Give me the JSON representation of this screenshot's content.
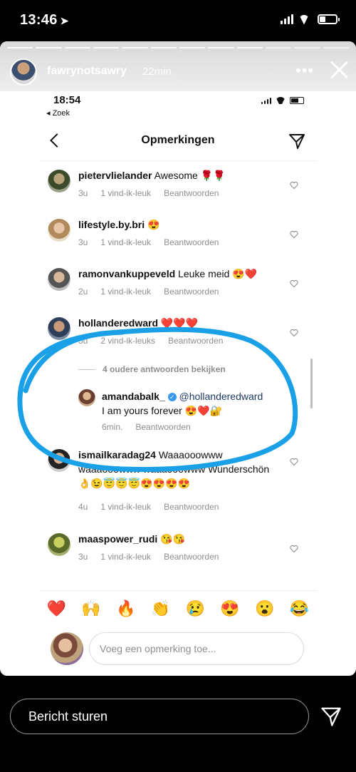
{
  "status_bar": {
    "time": "13:46"
  },
  "story": {
    "username": "fawrynotsawry",
    "time_ago": "22min.",
    "more": "•••"
  },
  "inner": {
    "time": "18:54",
    "back_label": "◂ Zoek",
    "title": "Opmerkingen",
    "comments": [
      {
        "user": "pietervlielander",
        "text": "Awesome 🌹🌹",
        "age": "3u",
        "likes": "1 vind-ik-leuk",
        "reply": "Beantwoorden"
      },
      {
        "user": "lifestyle.by.bri",
        "text": "😍",
        "age": "3u",
        "likes": "1 vind-ik-leuk",
        "reply": "Beantwoorden"
      },
      {
        "user": "ramonvankuppeveld",
        "text": "Leuke meid 😍❤️",
        "age": "2u",
        "likes": "1 vind-ik-leuk",
        "reply": "Beantwoorden"
      },
      {
        "user": "hollanderedward",
        "text": "❤️❤️❤️",
        "age": "5u",
        "likes": "2 vind-ik-leuks",
        "reply": "Beantwoorden"
      },
      {
        "user": "ismailkaradag24",
        "text": "Waaaooowww waaaooowww waaaooowww Wunderschön 👌😉😇😇😇😍😍😍😍",
        "age": "4u",
        "likes": "1 vind-ik-leuk",
        "reply": "Beantwoorden"
      },
      {
        "user": "maaspower_rudi",
        "text": "😘😘",
        "age": "3u",
        "likes": "1 vind-ik-leuk",
        "reply": "Beantwoorden"
      }
    ],
    "view_replies": "4 oudere antwoorden bekijken",
    "reply": {
      "user": "amandabalk_",
      "mention": "@hollanderedward",
      "text": "I am yours forever 😍❤️🔐",
      "age": "6min.",
      "reply_label": "Beantwoorden"
    },
    "emoji_bar": [
      "❤️",
      "🙌",
      "🔥",
      "👏",
      "😢",
      "😍",
      "😮",
      "😂"
    ],
    "compose_placeholder": "Voeg een opmerking toe..."
  },
  "reply_bar": {
    "placeholder": "Bericht sturen"
  },
  "colors": {
    "highlight": "#1aa0e6",
    "mention": "#1e3a63",
    "meta": "#8e8e8e",
    "verified": "#3897f0"
  }
}
